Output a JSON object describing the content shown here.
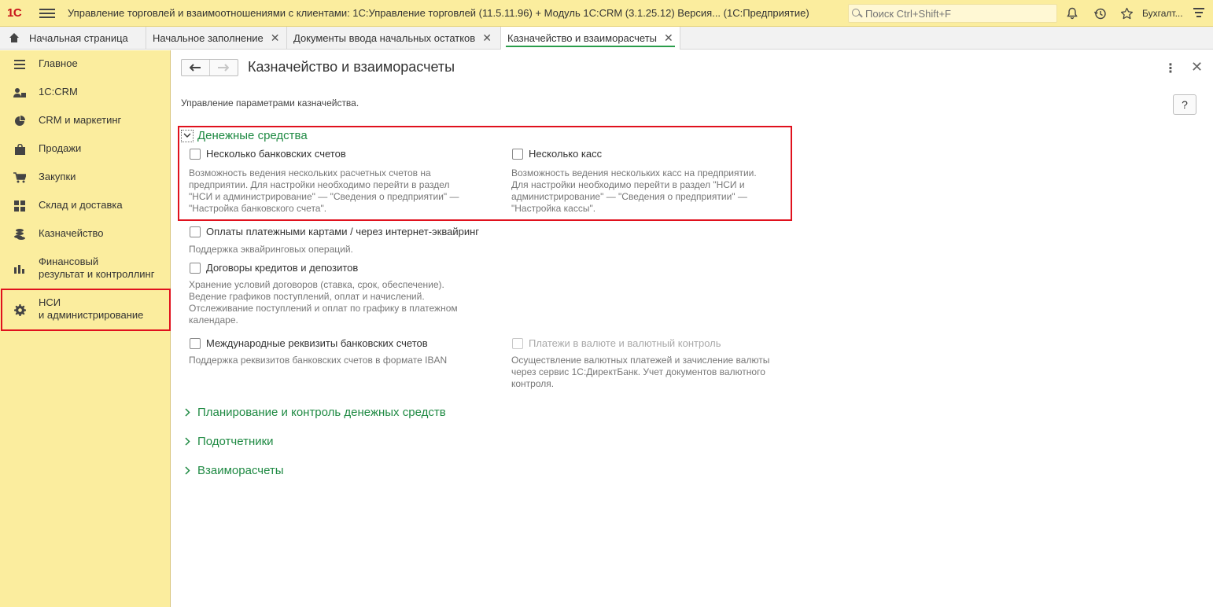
{
  "titlebar": {
    "logo": "1С",
    "app_title": "Управление торговлей и взаимоотношениями с клиентами: 1С:Управление торговлей (11.5.11.96) + Модуль 1С:CRM (3.1.25.12) Версия...   (1С:Предприятие)",
    "search_placeholder": "Поиск Ctrl+Shift+F",
    "user": "Бухгалт..."
  },
  "tabs": [
    {
      "label": "Начальная страница"
    },
    {
      "label": "Начальное заполнение"
    },
    {
      "label": "Документы ввода начальных остатков"
    },
    {
      "label": "Казначейство и взаиморасчеты"
    }
  ],
  "sidebar": {
    "items": [
      {
        "label": "Главное",
        "icon": "list-icon"
      },
      {
        "label": "1С:CRM",
        "icon": "people-icon"
      },
      {
        "label": "CRM и маркетинг",
        "icon": "pie-chart-icon"
      },
      {
        "label": "Продажи",
        "icon": "bag-icon"
      },
      {
        "label": "Закупки",
        "icon": "cart-icon"
      },
      {
        "label": "Склад и доставка",
        "icon": "grid-icon"
      },
      {
        "label": "Казначейство",
        "icon": "coins-icon"
      },
      {
        "label": "Финансовый\nрезультат и контроллинг",
        "icon": "bar-chart-icon"
      },
      {
        "label": "НСИ\nи администрирование",
        "icon": "gear-icon"
      }
    ]
  },
  "form": {
    "title": "Казначейство и взаиморасчеты",
    "subtitle": "Управление параметрами казначейства.",
    "help": "?",
    "sections": {
      "money": "Денежные средства",
      "planning": "Планирование и контроль денежных средств",
      "accountables": "Подотчетники",
      "settlements": "Взаиморасчеты"
    },
    "options": {
      "bank_accounts": {
        "label": "Несколько банковских счетов",
        "checked": false,
        "desc": "Возможность ведения нескольких расчетных счетов на\nпредприятии. Для настройки необходимо перейти в раздел\n\"НСИ и администрирование\" — \"Сведения о предприятии\" —\n\"Настройка банковского счета\"."
      },
      "cash_desks": {
        "label": "Несколько касс",
        "checked": false,
        "desc": "Возможность ведения нескольких касс на предприятии.\nДля настройки необходимо перейти в раздел \"НСИ и\nадминистрирование\" — \"Сведения о предприятии\" —\n\"Настройка кассы\"."
      },
      "card_payments": {
        "label": "Оплаты платежными картами / через интернет-эквайринг",
        "checked": false,
        "desc": "Поддержка эквайринговых операций."
      },
      "loans": {
        "label": "Договоры кредитов и депозитов",
        "checked": false,
        "desc": "Хранение условий договоров (ставка, срок, обеспечение).\nВедение графиков поступлений, оплат и начислений.\nОтслеживание поступлений и оплат по графику в платежном\nкалендаре."
      },
      "intl_requisites": {
        "label": "Международные реквизиты банковских счетов",
        "checked": false,
        "desc": "Поддержка реквизитов банковских счетов в формате IBAN"
      },
      "currency_payments": {
        "label": "Платежи в валюте и валютный контроль",
        "checked": false,
        "disabled": true,
        "desc": "Осуществление валютных платежей и зачисление валюты\nчерез сервис 1С:ДиректБанк. Учет документов валютного\nконтроля."
      }
    }
  },
  "colors": {
    "titlebar_bg": "#fbed9e",
    "accent_green": "#1f8a43",
    "highlight_red": "#e0111d"
  }
}
